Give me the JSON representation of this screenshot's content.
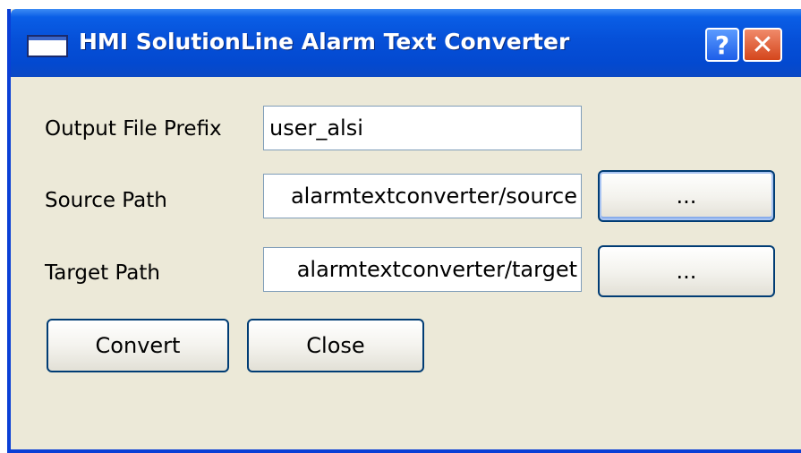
{
  "window": {
    "title": "HMI SolutionLine Alarm Text Converter",
    "help_label": "?",
    "close_label": "✕"
  },
  "form": {
    "prefix_label": "Output File Prefix",
    "prefix_value": "user_alsi",
    "source_label": "Source Path",
    "source_value": "alarmtextconverter/source",
    "target_label": "Target Path",
    "target_value": "alarmtextconverter/target",
    "browse_label": "..."
  },
  "actions": {
    "convert_label": "Convert",
    "close_label": "Close"
  },
  "colors": {
    "titlebar": "#0650d8",
    "window_bg": "#ece9d8",
    "button_border": "#003c74"
  }
}
